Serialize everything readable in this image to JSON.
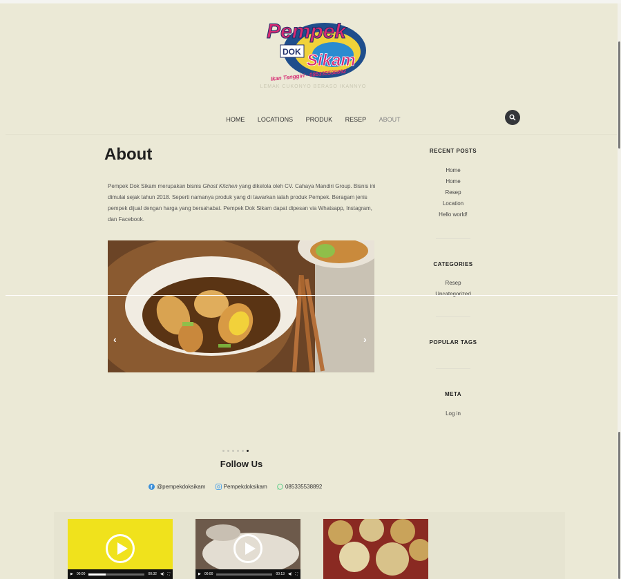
{
  "site": {
    "logo": {
      "line1": "Pempek",
      "line2": "DOK",
      "line3": "Sikam",
      "line4": "Ikan Tenggiri - 085335538892"
    },
    "tagline": "LEMAK CUKONYO BERASO IKANNYO"
  },
  "nav": {
    "items": [
      "HOME",
      "LOCATIONS",
      "PRODUK",
      "RESEP",
      "ABOUT"
    ],
    "search_icon": "search-icon"
  },
  "main": {
    "title": "About",
    "intro_part1": "Pempek Dok Sikam merupakan bisnis ",
    "intro_em": "Ghost Kitchen",
    "intro_part2": " yang dikelola oleh CV. Cahaya Mandiri Group. Bisnis ini dimulai sejak tahun 2018. Seperti namanya produk yang di tawarkan ialah produk Pempek. Beragam jenis pempek dijual dengan harga yang bersahabat. Pempek Dok Sikam dapat dipesan via Whatsapp, Instagram, dan Facebook.",
    "slider": {
      "prev": "‹",
      "next": "›",
      "active_dot": 6,
      "dot_count": 6
    },
    "follow_title": "Follow Us",
    "social": [
      {
        "icon": "facebook-icon",
        "label": "@pempekdoksikam",
        "color": "#3b8fd9"
      },
      {
        "icon": "instagram-icon",
        "label": "Pempekdoksikam",
        "color": "#5aa8e6"
      },
      {
        "icon": "whatsapp-icon",
        "label": "085335538892",
        "color": "#5fcf8a"
      }
    ]
  },
  "sidebar": {
    "recent_posts": {
      "title": "RECENT POSTS",
      "items": [
        "Home",
        "Home",
        "Resep",
        "Location",
        "Hello world!"
      ]
    },
    "categories": {
      "title": "CATEGORIES",
      "items": [
        "Resep",
        "Uncategorized"
      ]
    },
    "popular_tags": {
      "title": "POPULAR TAGS"
    },
    "meta": {
      "title": "META",
      "items": [
        "Log in"
      ]
    }
  },
  "videos": [
    {
      "time": "00:00",
      "duration": "00:32"
    },
    {
      "time": "00:00",
      "duration": "00:13"
    }
  ],
  "colors": {
    "background": "#ebe9d6",
    "accent_dark": "#34363a"
  }
}
